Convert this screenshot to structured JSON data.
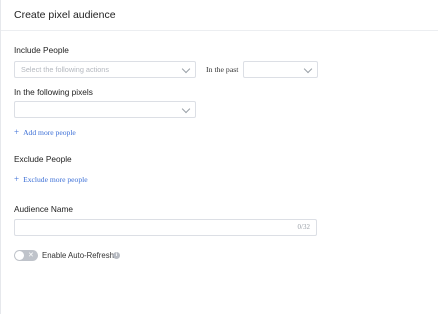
{
  "panel": {
    "title": "Create pixel audience"
  },
  "include": {
    "label": "Include People",
    "actions_placeholder": "Select the following actions",
    "past_label": "In the past",
    "past_value": ""
  },
  "pixels": {
    "label": "In the following pixels",
    "value": ""
  },
  "add_more": {
    "label": "Add more people"
  },
  "exclude": {
    "label": "Exclude People",
    "link_label": "Exclude more people"
  },
  "audience_name": {
    "label": "Audience Name",
    "value": "",
    "counter": "0/32"
  },
  "auto_refresh": {
    "label": "Enable Auto-Refresh",
    "toggle_symbol": "✕",
    "enabled": false
  },
  "icons": {
    "chevron": "chevron-down-icon",
    "plus": "plus-icon",
    "info": "info-icon",
    "close": "close-icon"
  },
  "colors": {
    "link": "#3a6ed6",
    "border": "#dcdfe5",
    "toggle_off": "#bfc3ca"
  }
}
